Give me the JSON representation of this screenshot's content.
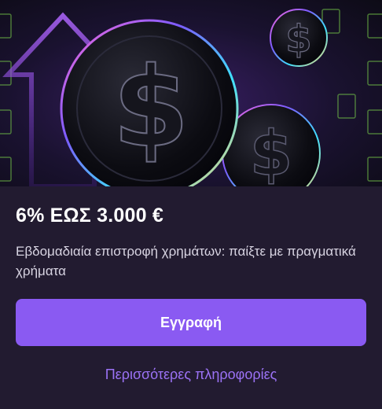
{
  "promo": {
    "title": "6% ΕΩΣ 3.000 €",
    "subtitle": "Εβδομαδιαία επιστροφή χρημάτων: παίξτε με πραγματικά χρήματα",
    "cta_label": "Εγγραφή",
    "more_label": "Περισσότερες πληροφορίες"
  },
  "hero": {
    "icons": [
      "dollar-coin-icon",
      "arrow-up-icon",
      "banknote-icon"
    ]
  },
  "colors": {
    "accent": "#8a5af2",
    "link": "#9b72f5",
    "background": "#221b30"
  }
}
